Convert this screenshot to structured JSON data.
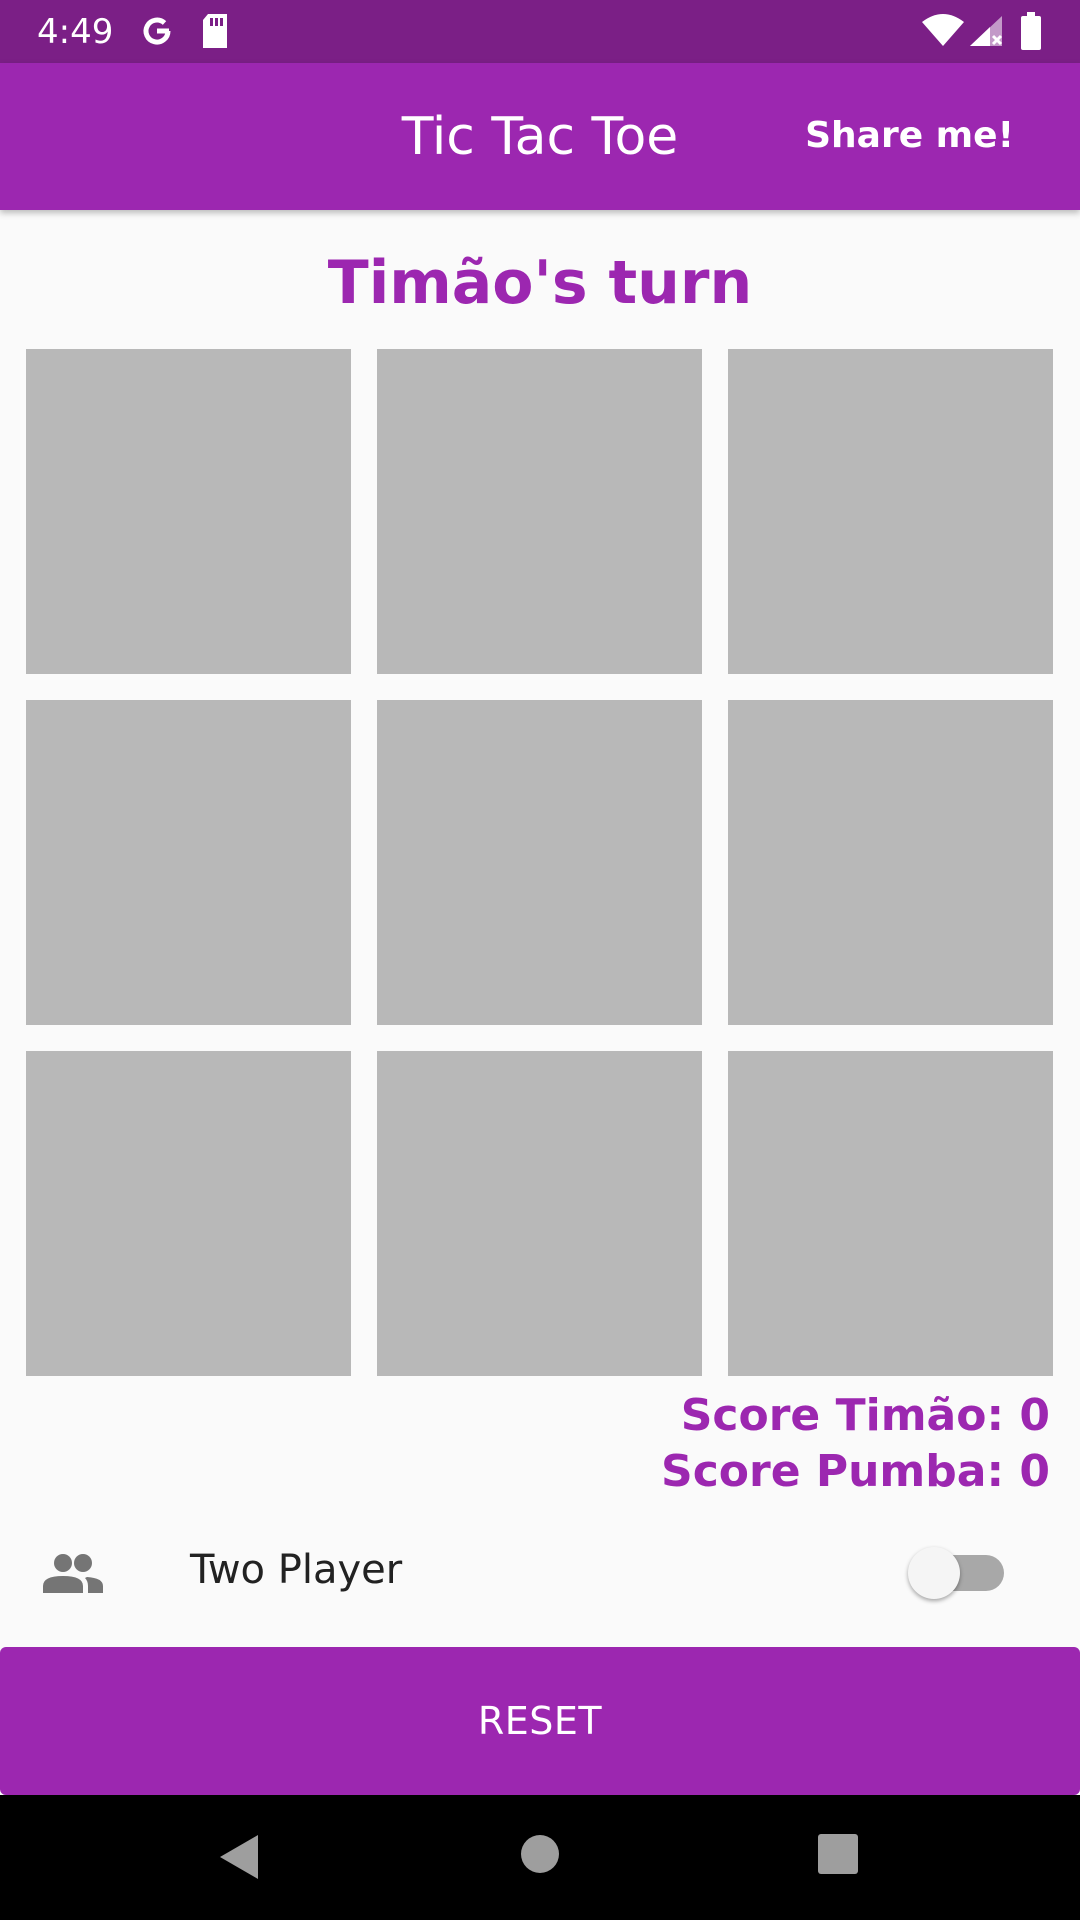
{
  "status_bar": {
    "time": "4:49",
    "icons": [
      "google-g-icon",
      "sd-card-icon",
      "wifi-icon",
      "signal-no-data-icon",
      "battery-icon"
    ]
  },
  "app_bar": {
    "title": "Tic Tac Toe",
    "share_label": "Share me!"
  },
  "game": {
    "turn_text": "Timão's turn",
    "board_cells": [
      "",
      "",
      "",
      "",
      "",
      "",
      "",
      "",
      ""
    ],
    "score_player1": "Score Timão: 0",
    "score_player2": "Score Pumba: 0"
  },
  "mode": {
    "icon": "people-icon",
    "label": "Two Player",
    "two_player_enabled": false
  },
  "reset_label": "RESET",
  "nav_bar": {
    "icons": [
      "back-icon",
      "home-icon",
      "recents-icon"
    ]
  },
  "colors": {
    "primary": "#9c27b0",
    "primary_dark": "#7b1f86",
    "cell": "#b8b8b8",
    "background": "#fafafa"
  }
}
